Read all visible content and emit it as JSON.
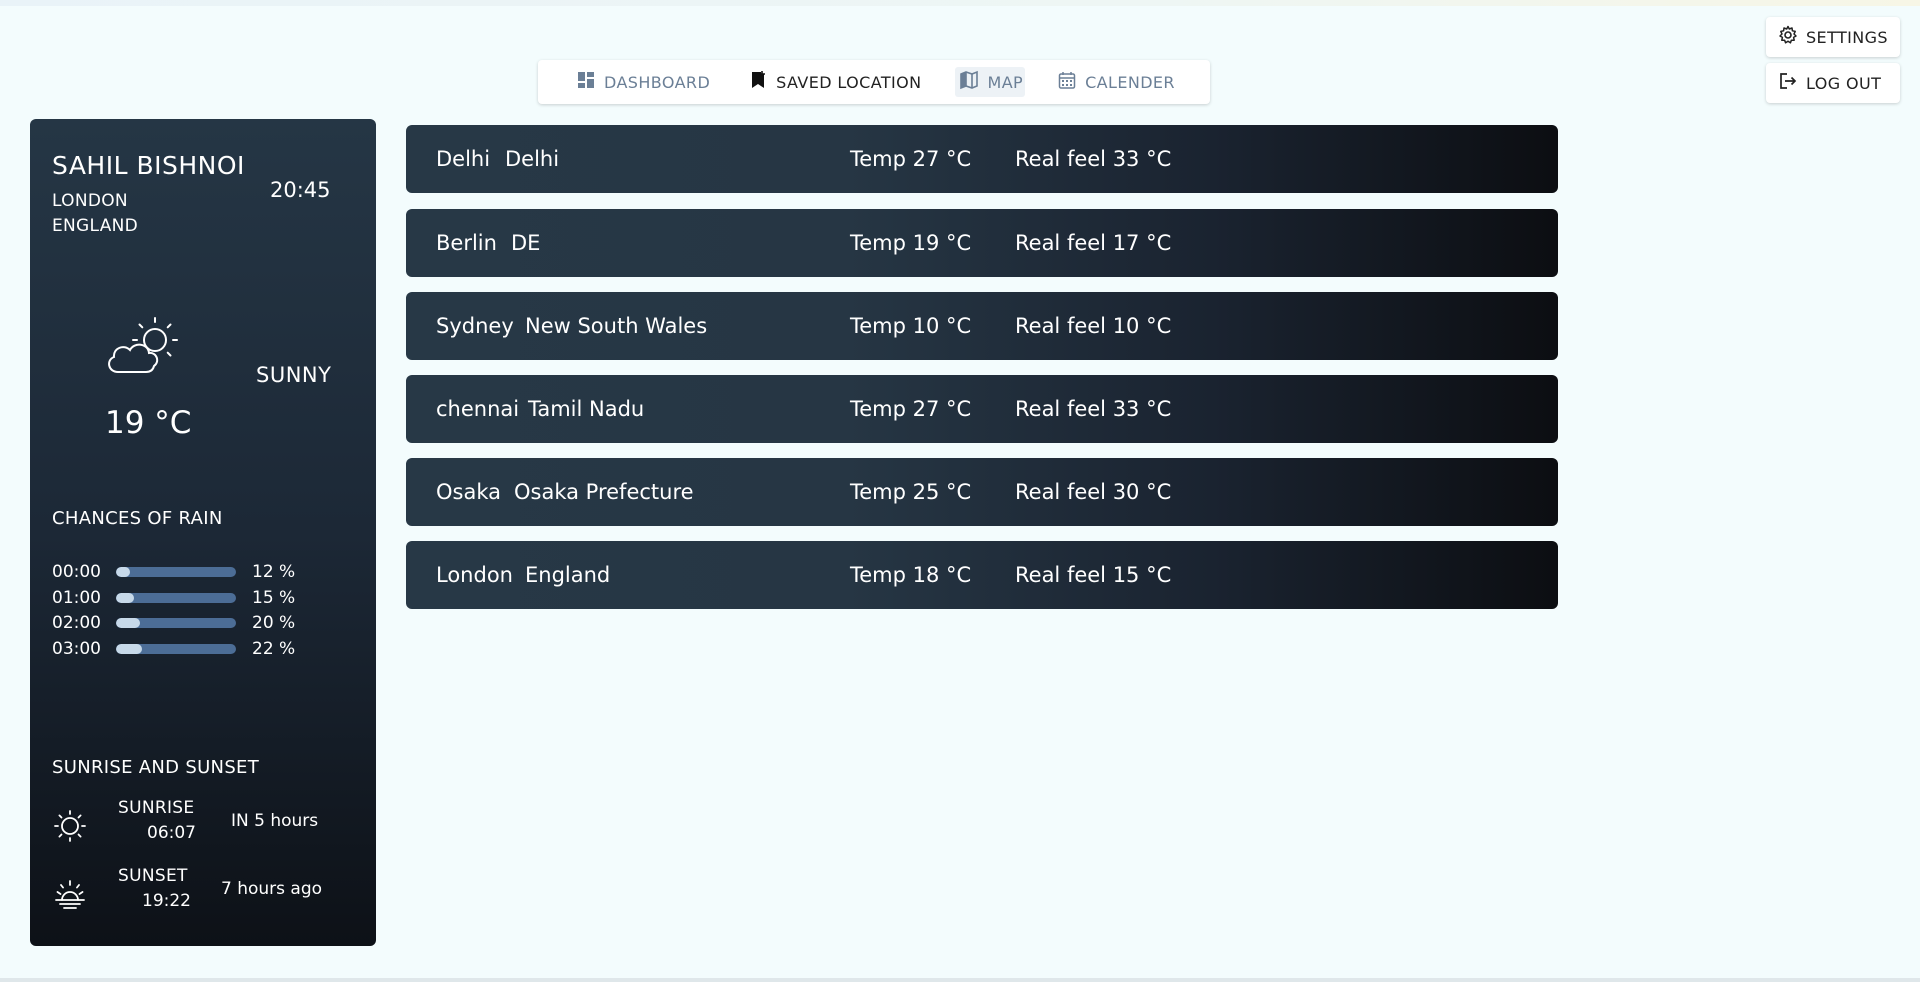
{
  "nav": {
    "items": [
      {
        "label": "DASHBOARD",
        "icon": "dashboard-icon"
      },
      {
        "label": "SAVED LOCATION",
        "icon": "bookmark-icon"
      },
      {
        "label": "MAP",
        "icon": "map-icon"
      },
      {
        "label": "CALENDER",
        "icon": "calendar-icon"
      }
    ]
  },
  "topbar": {
    "settings_label": "SETTINGS",
    "logout_label": "LOG OUT"
  },
  "panel": {
    "name": "SAHIL BISHNOI",
    "city": "LONDON",
    "country": "ENGLAND",
    "time": "20:45",
    "condition": "SUNNY",
    "temperature": "19 °C",
    "weather_icon": "partly-cloudy-icon",
    "rain_title": "CHANCES OF RAIN",
    "rain": [
      {
        "time": "00:00",
        "percent": 12,
        "label": "12 %"
      },
      {
        "time": "01:00",
        "percent": 15,
        "label": "15 %"
      },
      {
        "time": "02:00",
        "percent": 20,
        "label": "20 %"
      },
      {
        "time": "03:00",
        "percent": 22,
        "label": "22 %"
      }
    ],
    "sun_title": "SUNRISE AND SUNSET",
    "sunrise": {
      "label": "SUNRISE",
      "time": "06:07",
      "relative": "IN 5 hours"
    },
    "sunset": {
      "label": "SUNSET",
      "time": "19:22",
      "relative": "7 hours ago"
    }
  },
  "locations": [
    {
      "city": "Delhi",
      "region": "Delhi",
      "temp": "Temp 27 °C",
      "feel": "Real feel 33 °C"
    },
    {
      "city": "Berlin",
      "region": "DE",
      "temp": "Temp 19 °C",
      "feel": "Real feel 17 °C"
    },
    {
      "city": "Sydney",
      "region": "New South Wales",
      "temp": "Temp 10 °C",
      "feel": "Real feel 10 °C"
    },
    {
      "city": "chennai",
      "region": "Tamil Nadu",
      "temp": "Temp 27 °C",
      "feel": "Real feel 33 °C"
    },
    {
      "city": "Osaka",
      "region": "Osaka Prefecture",
      "temp": "Temp 25 °C",
      "feel": "Real feel 30 °C"
    },
    {
      "city": "London",
      "region": "England",
      "temp": "Temp 18 °C",
      "feel": "Real feel 15 °C"
    }
  ],
  "colors": {
    "background": "#f3fcfd",
    "panel_top": "#253645",
    "panel_bottom": "#0d1117",
    "rain_track": "#4c6d96",
    "rain_fill": "#c7d9e9",
    "nav_inactive": "#6b7f96"
  }
}
